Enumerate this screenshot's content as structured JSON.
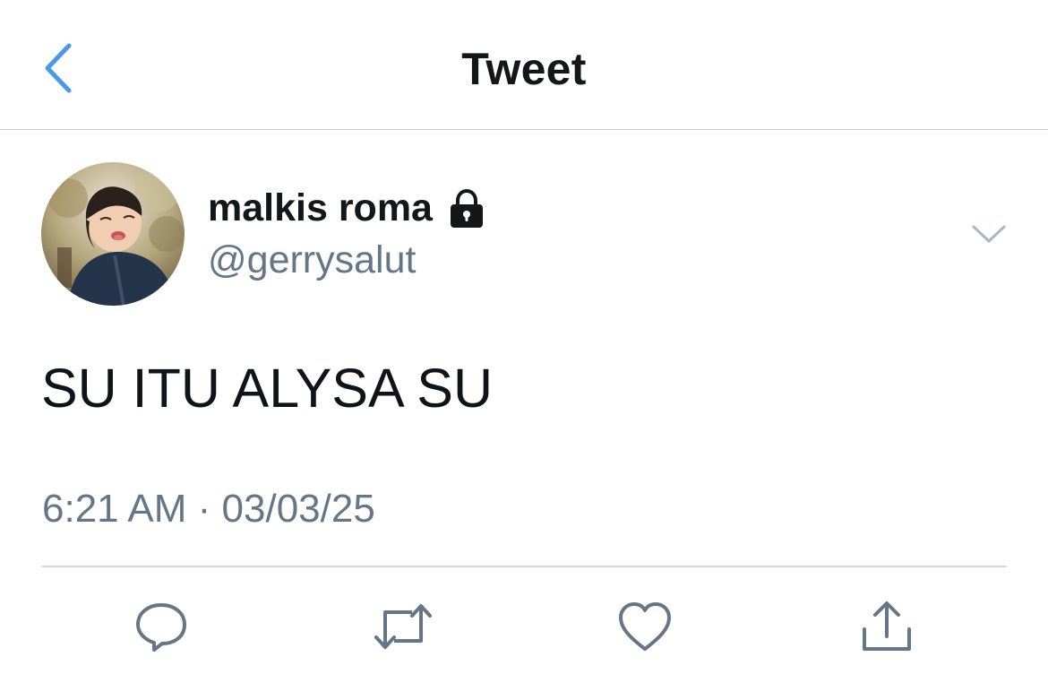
{
  "header": {
    "title": "Tweet",
    "back_icon": "chevron-left-icon",
    "accent": "#4a98e8"
  },
  "tweet": {
    "author": {
      "display_name": "malkis roma",
      "handle": "@gerrysalut",
      "protected_icon": "lock-icon"
    },
    "more_icon": "chevron-down-icon",
    "text": "SU ITU ALYSA SU",
    "timestamp": "6:21 AM · 03/03/25"
  },
  "actions": [
    {
      "name": "reply",
      "icon": "comment-icon"
    },
    {
      "name": "retweet",
      "icon": "retweet-icon"
    },
    {
      "name": "like",
      "icon": "heart-icon"
    },
    {
      "name": "share",
      "icon": "share-icon"
    }
  ],
  "colors": {
    "text_primary": "#14171a",
    "text_secondary": "#657786",
    "divider": "#d4d7da",
    "icon": "#657786"
  }
}
